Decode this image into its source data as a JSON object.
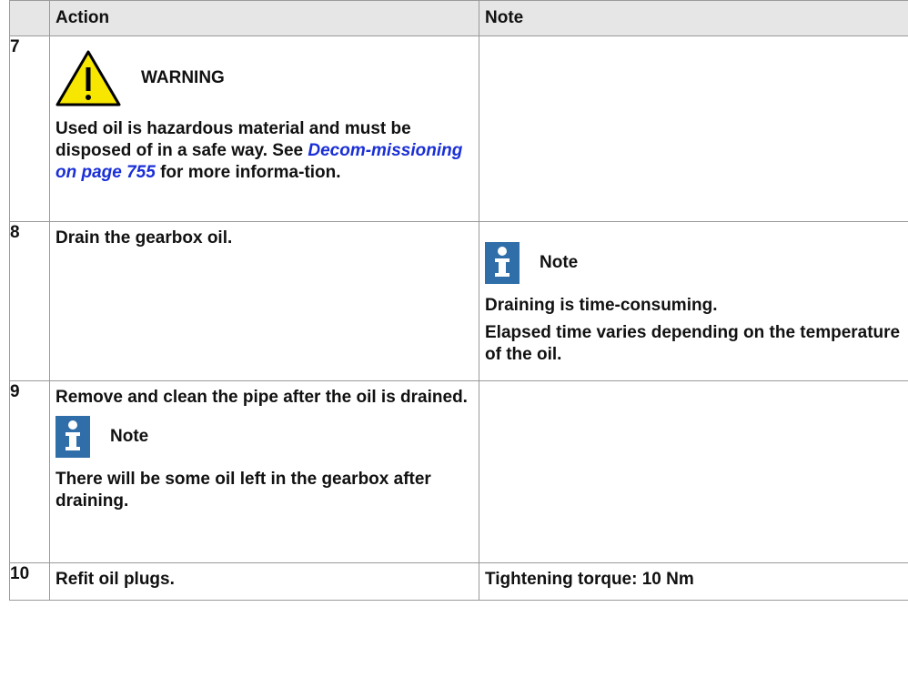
{
  "header": {
    "step": "",
    "action": "Action",
    "note": "Note"
  },
  "rows": [
    {
      "step": "7",
      "warning": {
        "title": "WARNING",
        "text_before_link": "Used oil is hazardous material and must be disposed of in a safe way. See ",
        "link": "Decom-missioning on page 755",
        "text_after_link": " for more informa-tion."
      },
      "note": ""
    },
    {
      "step": "8",
      "action": "Drain the gearbox oil.",
      "note_callout": {
        "title": "Note",
        "lines": [
          "Draining is time-consuming.",
          "Elapsed time varies depending on the temperature of the oil."
        ]
      }
    },
    {
      "step": "9",
      "action": "Remove and clean the pipe after the oil is drained.",
      "action_callout": {
        "title": "Note",
        "text": "There will be some oil left in the gearbox after draining."
      },
      "note": ""
    },
    {
      "step": "10",
      "action": "Refit oil plugs.",
      "note": "Tightening torque: 10 Nm"
    }
  ],
  "colors": {
    "header_bg": "#e6e6e6",
    "warning_yellow": "#f7e600",
    "note_blue": "#2f6ea8",
    "link": "#1a2fd6"
  },
  "icons": [
    "warning-icon",
    "info-note-icon"
  ]
}
